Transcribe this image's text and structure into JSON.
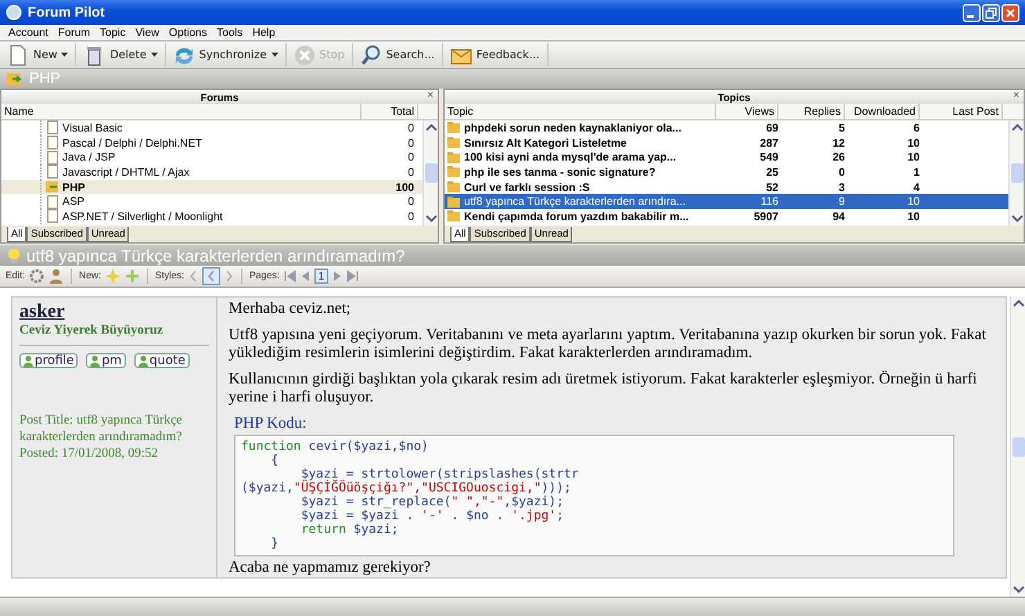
{
  "window": {
    "title": "Forum Pilot"
  },
  "menu": [
    "Account",
    "Forum",
    "Topic",
    "View",
    "Options",
    "Tools",
    "Help"
  ],
  "toolbar": [
    {
      "kind": "new",
      "label": "New",
      "dropdown": true,
      "disabled": false
    },
    {
      "kind": "delete",
      "label": "Delete",
      "dropdown": true,
      "disabled": false
    },
    {
      "kind": "sync",
      "label": "Synchronize",
      "dropdown": true,
      "disabled": false
    },
    {
      "kind": "stop",
      "label": "Stop",
      "dropdown": false,
      "disabled": true
    },
    {
      "kind": "search",
      "label": "Search...",
      "dropdown": false,
      "disabled": false
    },
    {
      "kind": "feedback",
      "label": "Feedback...",
      "dropdown": false,
      "disabled": false
    }
  ],
  "forum_header": {
    "title": "PHP"
  },
  "forums": {
    "title": "Forums",
    "close": "×",
    "columns": [
      "Name",
      "Total"
    ],
    "rows": [
      {
        "name": "Visual Basic",
        "total": "0",
        "selected": false
      },
      {
        "name": "Pascal / Delphi / Delphi.NET",
        "total": "0",
        "selected": false
      },
      {
        "name": "Java / JSP",
        "total": "0",
        "selected": false
      },
      {
        "name": "Javascript / DHTML / Ajax",
        "total": "0",
        "selected": false
      },
      {
        "name": "PHP",
        "total": "100",
        "selected": true
      },
      {
        "name": "ASP",
        "total": "0",
        "selected": false
      },
      {
        "name": "ASP.NET / Silverlight / Moonlight",
        "total": "0",
        "selected": false
      }
    ],
    "tabs": [
      {
        "label": "All",
        "selected": true
      },
      {
        "label": "Subscribed",
        "selected": false
      },
      {
        "label": "Unread",
        "selected": false
      }
    ]
  },
  "topics": {
    "title": "Topics",
    "close": "×",
    "columns": [
      "Topic",
      "Views",
      "Replies",
      "Downloaded",
      "Last Post"
    ],
    "rows": [
      {
        "topic": "phpdeki sorun neden kaynaklaniyor ola...",
        "views": "69",
        "replies": "5",
        "downloaded": "6",
        "unread": true,
        "selected": false
      },
      {
        "topic": "Sınırsız Alt Kategori Listeletme",
        "views": "287",
        "replies": "12",
        "downloaded": "10",
        "unread": true,
        "selected": false
      },
      {
        "topic": "100 kisi ayni anda mysql'de arama yap...",
        "views": "549",
        "replies": "26",
        "downloaded": "10",
        "unread": true,
        "selected": false
      },
      {
        "topic": "php ile ses tanma - sonic signature?",
        "views": "25",
        "replies": "0",
        "downloaded": "1",
        "unread": true,
        "selected": false
      },
      {
        "topic": "Curl ve farklı session :S",
        "views": "52",
        "replies": "3",
        "downloaded": "4",
        "unread": true,
        "selected": false
      },
      {
        "topic": "utf8 yapınca Türkçe karakterlerden arındıra...",
        "views": "116",
        "replies": "9",
        "downloaded": "10",
        "unread": false,
        "selected": true
      },
      {
        "topic": "Kendi çapımda forum yazdım bakabilir m...",
        "views": "5907",
        "replies": "94",
        "downloaded": "10",
        "unread": true,
        "selected": false
      }
    ],
    "tabs": [
      {
        "label": "All",
        "selected": true
      },
      {
        "label": "Subscribed",
        "selected": false
      },
      {
        "label": "Unread",
        "selected": false
      }
    ]
  },
  "topic_header": {
    "title": "utf8 yapınca Türkçe karakterlerden arındıramadım?"
  },
  "topic_toolbar": {
    "edit_label": "Edit:",
    "new_label": "New:",
    "styles_label": "Styles:",
    "pages_label": "Pages:",
    "page": "1"
  },
  "post": {
    "author": "asker",
    "rank": "Ceviz Yiyerek Büyüyoruz",
    "buttons": [
      "profile",
      "pm",
      "quote"
    ],
    "meta": [
      "Post Title: utf8 yapınca Türkçe karakterlerden arındıramadım?",
      "Posted: 17/01/2008, 09:52"
    ],
    "paragraphs": [
      "Merhaba ceviz.net;",
      "Utf8 yapısına yeni geçiyorum. Veritabanını ve meta ayarlarını yaptım. Veritabanına yazıp okurken bir sorun yok. Fakat yüklediğim resimlerin isimlerini değiştirdim. Fakat karakterlerden arındıramadım.",
      "Kullanıcının girdiği başlıktan yola çıkarak resim adı üretmek istiyorum. Fakat karakterler eşleşmiyor. Örneğin ü harfi yerine i harfi oluşuyor."
    ],
    "code_title": "PHP Kodu:",
    "code": [
      [
        {
          "kind": "kw",
          "text": "function"
        },
        {
          "kind": "txt",
          "text": " cevir($yazi,$no)"
        }
      ],
      [
        {
          "kind": "txt",
          "text": "    {"
        }
      ],
      [
        {
          "kind": "txt",
          "text": "        $yazi = strtolower(stripslashes(strtr"
        }
      ],
      [
        {
          "kind": "txt",
          "text": "($yazi,"
        },
        {
          "kind": "str",
          "text": "\"ÜŞÇİĞÖüöşçiğı?\",\"USCIGOuoscigi,\""
        },
        {
          "kind": "txt",
          "text": ")));"
        }
      ],
      [
        {
          "kind": "txt",
          "text": "        $yazi = str_replace("
        },
        {
          "kind": "str",
          "text": "\" \",\"-\""
        },
        {
          "kind": "txt",
          "text": ",$yazi);"
        }
      ],
      [
        {
          "kind": "txt",
          "text": "        $yazi = $yazi . "
        },
        {
          "kind": "str",
          "text": "'-'"
        },
        {
          "kind": "txt",
          "text": " . $no . "
        },
        {
          "kind": "str",
          "text": "'.jpg'"
        },
        {
          "kind": "txt",
          "text": ";"
        }
      ],
      [
        {
          "kind": "kw",
          "text": "        return"
        },
        {
          "kind": "txt",
          "text": " $yazi;"
        }
      ],
      [
        {
          "kind": "txt",
          "text": "    }"
        }
      ]
    ],
    "closing": "Acaba ne yapmamız gerekiyor?"
  }
}
